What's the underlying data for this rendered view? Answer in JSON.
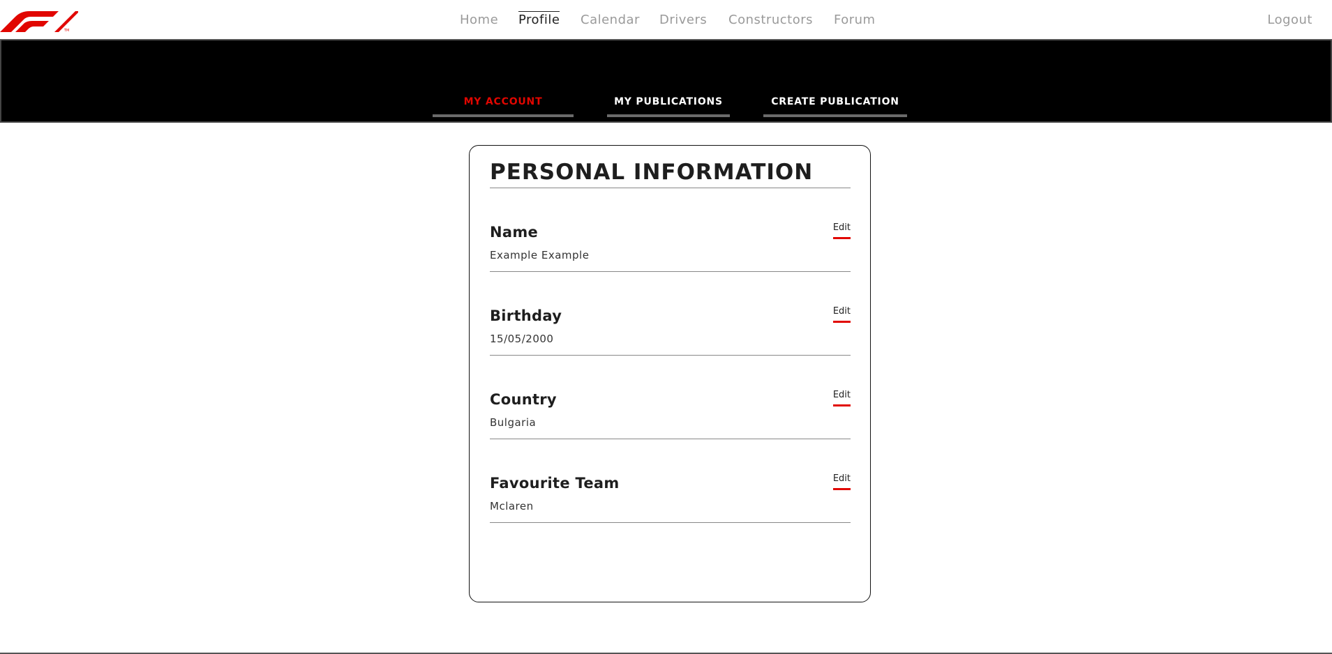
{
  "brand": {
    "accent": "#e10600",
    "logo": "f1-logo-icon"
  },
  "nav": {
    "items": [
      {
        "label": "Home"
      },
      {
        "label": "Profile"
      },
      {
        "label": "Calendar"
      },
      {
        "label": "Drivers"
      },
      {
        "label": "Constructors"
      },
      {
        "label": "Forum"
      }
    ],
    "active": "Profile",
    "logout": "Logout"
  },
  "tabs": [
    {
      "label": "MY ACCOUNT"
    },
    {
      "label": "MY PUBLICATIONS"
    },
    {
      "label": "CREATE PUBLICATION"
    }
  ],
  "active_tab": "MY ACCOUNT",
  "card": {
    "title": "PERSONAL INFORMATION",
    "fields": [
      {
        "label": "Name",
        "value": "Example Example",
        "edit": "Edit"
      },
      {
        "label": "Birthday",
        "value": "15/05/2000",
        "edit": "Edit"
      },
      {
        "label": "Country",
        "value": "Bulgaria",
        "edit": "Edit"
      },
      {
        "label": "Favourite Team",
        "value": "Mclaren",
        "edit": "Edit"
      }
    ]
  }
}
